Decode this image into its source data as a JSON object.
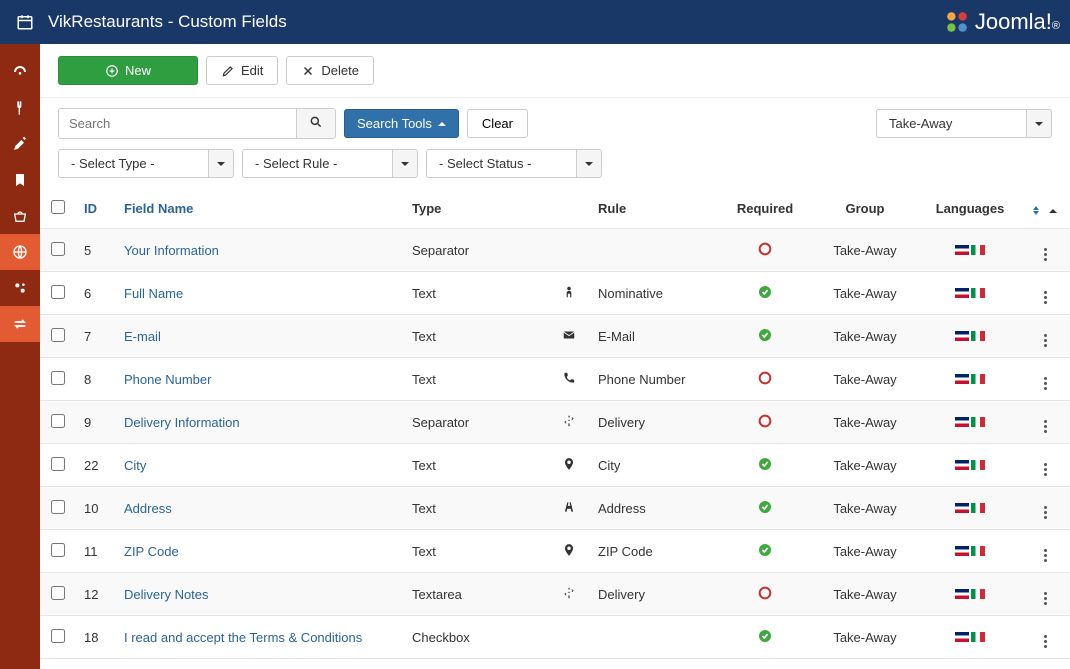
{
  "header": {
    "title": "VikRestaurants - Custom Fields",
    "logo_text": "Joomla!",
    "logo_reg": "®"
  },
  "toolbar": {
    "new_label": "New",
    "edit_label": "Edit",
    "delete_label": "Delete"
  },
  "filters": {
    "search_placeholder": "Search",
    "search_tools_label": "Search Tools",
    "clear_label": "Clear",
    "group_value": "Take-Away",
    "select_type": "- Select Type -",
    "select_rule": "- Select Rule -",
    "select_status": "- Select Status -"
  },
  "columns": {
    "id": "ID",
    "field_name": "Field Name",
    "type": "Type",
    "rule": "Rule",
    "required": "Required",
    "group": "Group",
    "languages": "Languages"
  },
  "rows": [
    {
      "id": "5",
      "name": "Your Information",
      "type": "Separator",
      "rule_icon": "",
      "rule": "",
      "required": false,
      "group": "Take-Away"
    },
    {
      "id": "6",
      "name": "Full Name",
      "type": "Text",
      "rule_icon": "person",
      "rule": "Nominative",
      "required": true,
      "group": "Take-Away"
    },
    {
      "id": "7",
      "name": "E-mail",
      "type": "Text",
      "rule_icon": "mail",
      "rule": "E-Mail",
      "required": true,
      "group": "Take-Away"
    },
    {
      "id": "8",
      "name": "Phone Number",
      "type": "Text",
      "rule_icon": "phone",
      "rule": "Phone Number",
      "required": false,
      "group": "Take-Away"
    },
    {
      "id": "9",
      "name": "Delivery Information",
      "type": "Separator",
      "rule_icon": "signpost",
      "rule": "Delivery",
      "required": false,
      "group": "Take-Away"
    },
    {
      "id": "22",
      "name": "City",
      "type": "Text",
      "rule_icon": "pin",
      "rule": "City",
      "required": true,
      "group": "Take-Away"
    },
    {
      "id": "10",
      "name": "Address",
      "type": "Text",
      "rule_icon": "road",
      "rule": "Address",
      "required": true,
      "group": "Take-Away"
    },
    {
      "id": "11",
      "name": "ZIP Code",
      "type": "Text",
      "rule_icon": "pin",
      "rule": "ZIP Code",
      "required": true,
      "group": "Take-Away"
    },
    {
      "id": "12",
      "name": "Delivery Notes",
      "type": "Textarea",
      "rule_icon": "signpost",
      "rule": "Delivery",
      "required": false,
      "group": "Take-Away"
    },
    {
      "id": "18",
      "name": "I read and accept the Terms & Conditions",
      "type": "Checkbox",
      "rule_icon": "",
      "rule": "",
      "required": true,
      "group": "Take-Away"
    }
  ]
}
